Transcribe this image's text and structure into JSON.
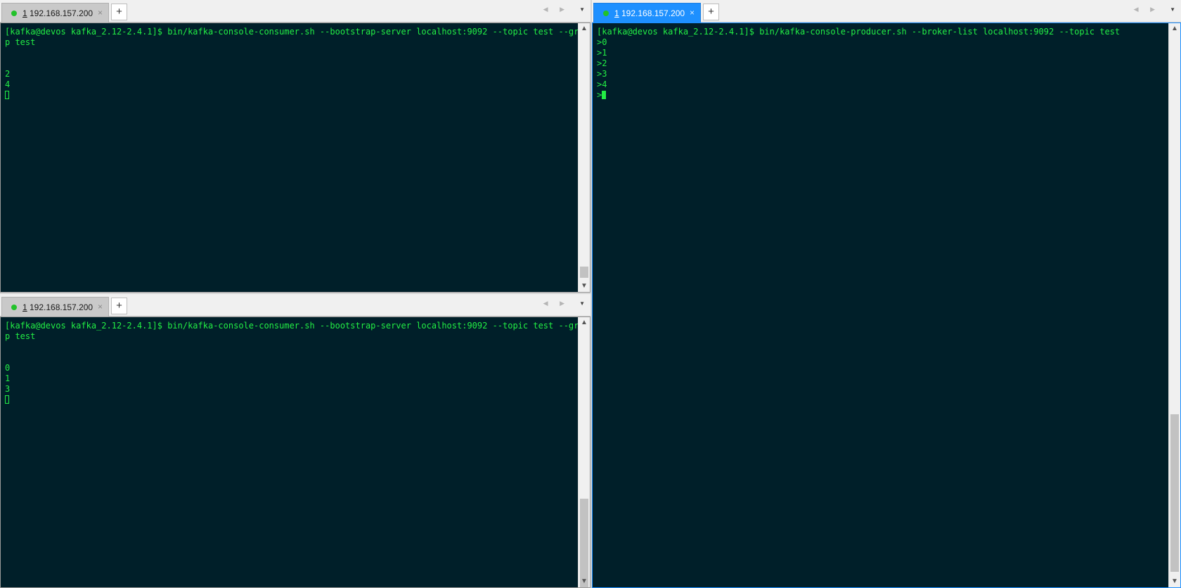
{
  "panes": {
    "top_left": {
      "tab": {
        "number": "1",
        "title": "192.168.157.200",
        "close": "×"
      },
      "add_tab": "+",
      "nav_arrows": "◀ ▶",
      "menu_arrow": "▼",
      "prompt_line1": "[kafka@devos kafka_2.12-2.4.1]$ bin/kafka-console-consumer.sh --bootstrap-server localhost:9092 --topic test --grou",
      "prompt_line2": "p test",
      "outputs": [
        "2",
        "4"
      ],
      "scroll": {
        "up": "▲",
        "down": "▼"
      }
    },
    "bottom_left": {
      "tab": {
        "number": "1",
        "title": "192.168.157.200",
        "close": "×"
      },
      "add_tab": "+",
      "nav_arrows": "◀ ▶",
      "menu_arrow": "▼",
      "prompt_line1": "[kafka@devos kafka_2.12-2.4.1]$ bin/kafka-console-consumer.sh --bootstrap-server localhost:9092 --topic test --grou",
      "prompt_line2": "p test",
      "outputs": [
        "0",
        "1",
        "3"
      ],
      "scroll": {
        "up": "▲",
        "down": "▼"
      }
    },
    "right": {
      "tab": {
        "number": "1",
        "title": "192.168.157.200",
        "close": "×"
      },
      "add_tab": "+",
      "nav_arrows": "◀ ▶",
      "menu_arrow": "▼",
      "prompt_line1": "[kafka@devos kafka_2.12-2.4.1]$ bin/kafka-console-producer.sh --broker-list localhost:9092 --topic test",
      "outputs": [
        ">0",
        ">1",
        ">2",
        ">3",
        ">4"
      ],
      "input_prompt": ">",
      "scroll": {
        "up": "▲",
        "down": "▼"
      }
    }
  }
}
